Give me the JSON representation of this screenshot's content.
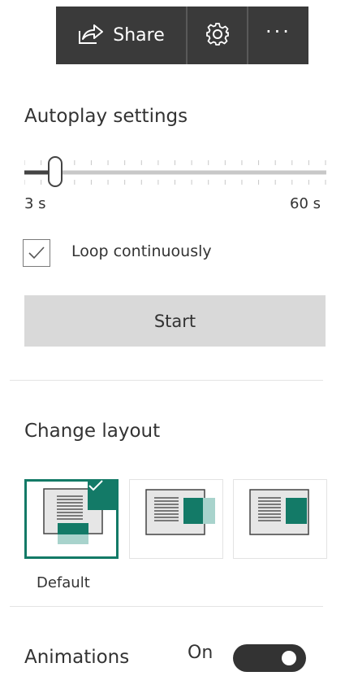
{
  "toolbar": {
    "share_label": "Share",
    "share_icon": "share-icon",
    "settings_icon": "gear-icon",
    "more_label": "···"
  },
  "autoplay": {
    "title": "Autoplay settings",
    "slider_min_label": "3 s",
    "slider_max_label": "60 s",
    "slider_value_fraction": 0.1,
    "loop_label": "Loop continuously",
    "loop_checked": true,
    "start_label": "Start"
  },
  "layout": {
    "title": "Change layout",
    "selected_index": 0,
    "options": [
      {
        "caption": "Default",
        "selected": true
      },
      {
        "caption": "",
        "selected": false
      },
      {
        "caption": "",
        "selected": false
      }
    ]
  },
  "animations": {
    "label": "Animations",
    "state_label": "On",
    "enabled": true
  },
  "colors": {
    "toolbar_bg": "#3a3a3a",
    "accent": "#137a67",
    "button_bg": "#d9d9d9"
  }
}
